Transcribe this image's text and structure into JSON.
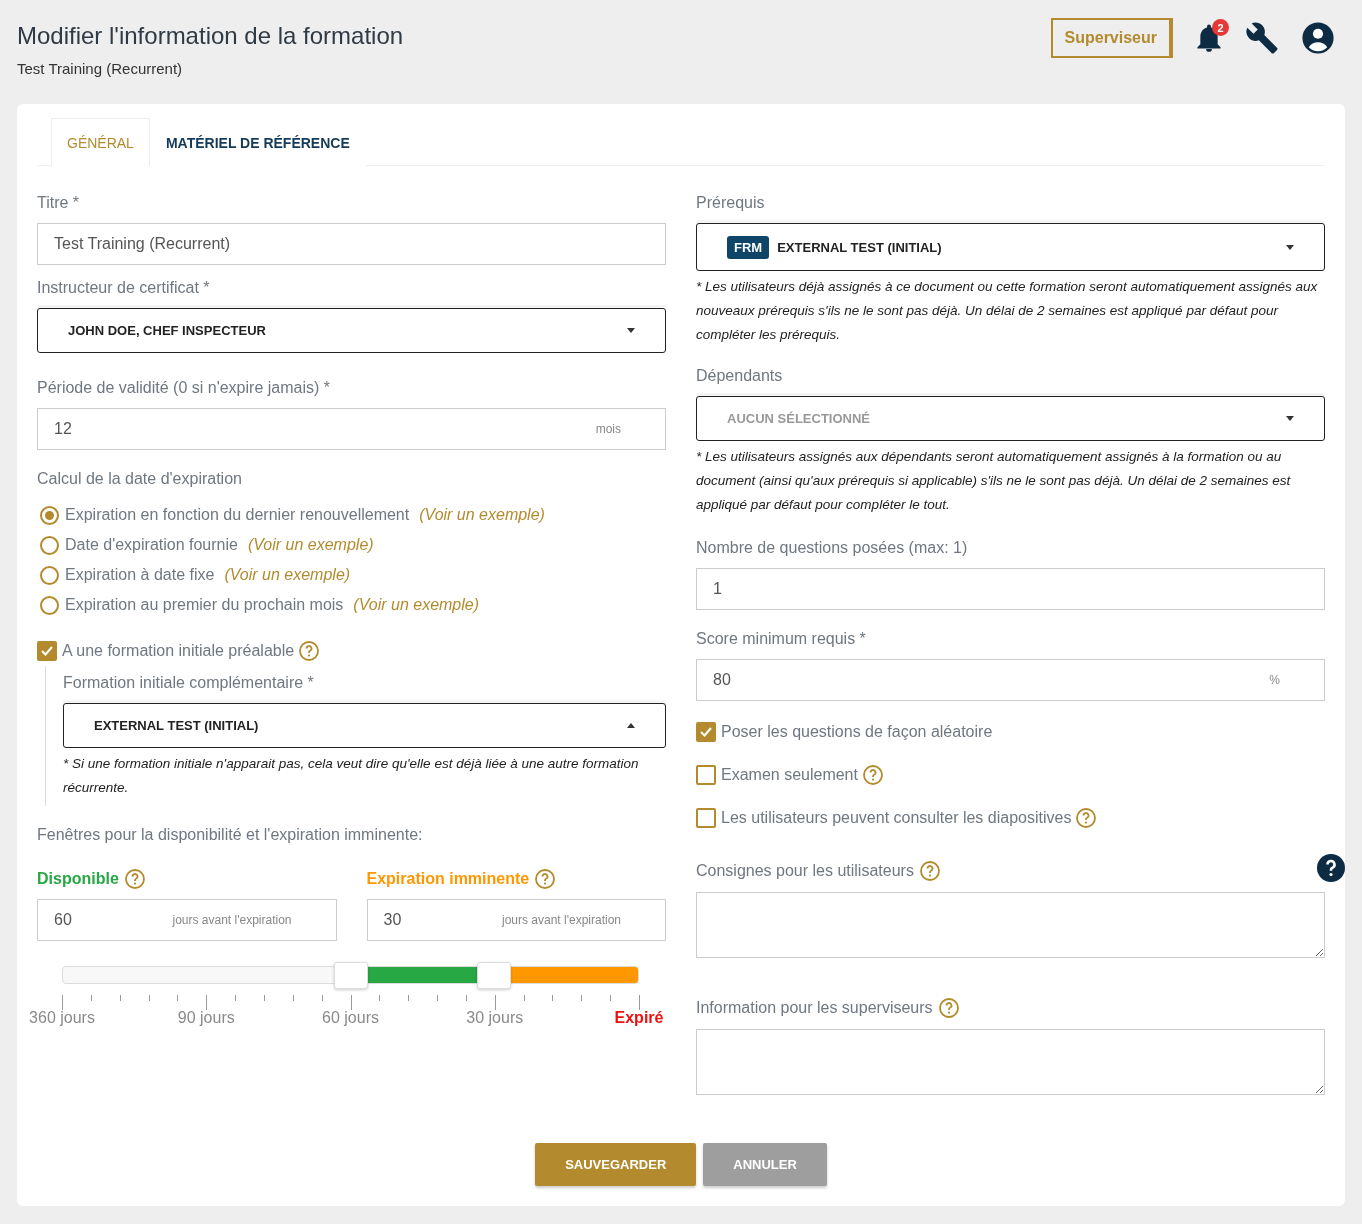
{
  "header": {
    "title": "Modifier l'information de la formation",
    "subtitle": "Test Training (Recurrent)",
    "role_button": "Superviseur",
    "notification_count": "2"
  },
  "tabs": [
    {
      "label": "GÉNÉRAL",
      "selected": true
    },
    {
      "label": "MATÉRIEL DE RÉFÉRENCE",
      "selected": false
    }
  ],
  "left": {
    "title_field": {
      "label": "Titre *",
      "value": "Test Training (Recurrent)"
    },
    "instructor": {
      "label": "Instructeur de certificat *",
      "value": "JOHN DOE, CHEF INSPECTEUR",
      "expanded": false
    },
    "validity": {
      "label": "Période de validité (0 si n'expire jamais) *",
      "value": "12",
      "unit": "mois"
    },
    "expiry_calc": {
      "label": "Calcul de la date d'expiration",
      "options": [
        {
          "label": "Expiration en fonction du dernier renouvellement",
          "link": "(Voir un exemple)",
          "selected": true
        },
        {
          "label": "Date d'expiration fournie",
          "link": "(Voir un exemple)",
          "selected": false
        },
        {
          "label": "Expiration à date fixe",
          "link": "(Voir un exemple)",
          "selected": false
        },
        {
          "label": "Expiration au premier du prochain mois",
          "link": "(Voir un exemple)",
          "selected": false
        }
      ]
    },
    "initial_training": {
      "label": "A une formation initiale préalable",
      "checked": true,
      "sub_label": "Formation initiale complémentaire *",
      "value": "EXTERNAL TEST (INITIAL)",
      "expanded": true,
      "note": "* Si une formation initiale n'apparait pas, cela veut dire qu'elle est déjà liée à une autre formation récurrente."
    },
    "windows": {
      "label": "Fenêtres pour la disponibilité et l'expiration imminente:",
      "fields": [
        {
          "label": "Disponible",
          "value": "60",
          "unit": "jours avant l'expiration",
          "color": "#28a745"
        },
        {
          "label": "Expiration imminente",
          "value": "30",
          "unit": "jours avant l'expiration",
          "color": "#ff9800"
        }
      ],
      "slider": {
        "thumbs": [
          {
            "level": 0.5
          },
          {
            "level": 0.75
          }
        ],
        "scale": [
          "360 jours",
          "90 jours",
          "60 jours",
          "30 jours",
          "Expiré"
        ]
      }
    }
  },
  "right": {
    "prerequisites": {
      "label": "Prérequis",
      "tag": "FRM",
      "value": "EXTERNAL TEST (INITIAL)",
      "expanded": false,
      "note": "* Les utilisateurs déjà assignés à ce document ou cette formation seront automatiquement assignés aux nouveaux prérequis s'ils ne le sont pas déjà. Un délai de 2 semaines est appliqué par défaut pour compléter les prérequis."
    },
    "dependants": {
      "label": "Dépendants",
      "placeholder": "AUCUN SÉLECTIONNÉ",
      "expanded": false,
      "note": "* Les utilisateurs assignés aux dépendants seront automatiquement assignés à la formation ou au document (ainsi qu'aux prérequis si applicable) s'ils ne le sont pas déjà. Un délai de 2 semaines est appliqué par défaut pour compléter le tout."
    },
    "questions": {
      "label": "Nombre de questions posées (max: 1)",
      "value": "1"
    },
    "min_score": {
      "label": "Score minimum requis *",
      "value": "80",
      "unit": "%"
    },
    "checkboxes": [
      {
        "label": "Poser les questions de façon aléatoire",
        "checked": true,
        "help": false
      },
      {
        "label": "Examen seulement",
        "checked": false,
        "help": true
      },
      {
        "label": "Les utilisateurs peuvent consulter les diapositives",
        "checked": false,
        "help": true
      }
    ],
    "textareas": [
      {
        "label": "Consignes pour les utilisateurs"
      },
      {
        "label": "Information pour les superviseurs"
      }
    ]
  },
  "actions": [
    {
      "label": "SAUVEGARDER",
      "kind": "primary"
    },
    {
      "label": "ANNULER",
      "kind": "secondary"
    }
  ]
}
